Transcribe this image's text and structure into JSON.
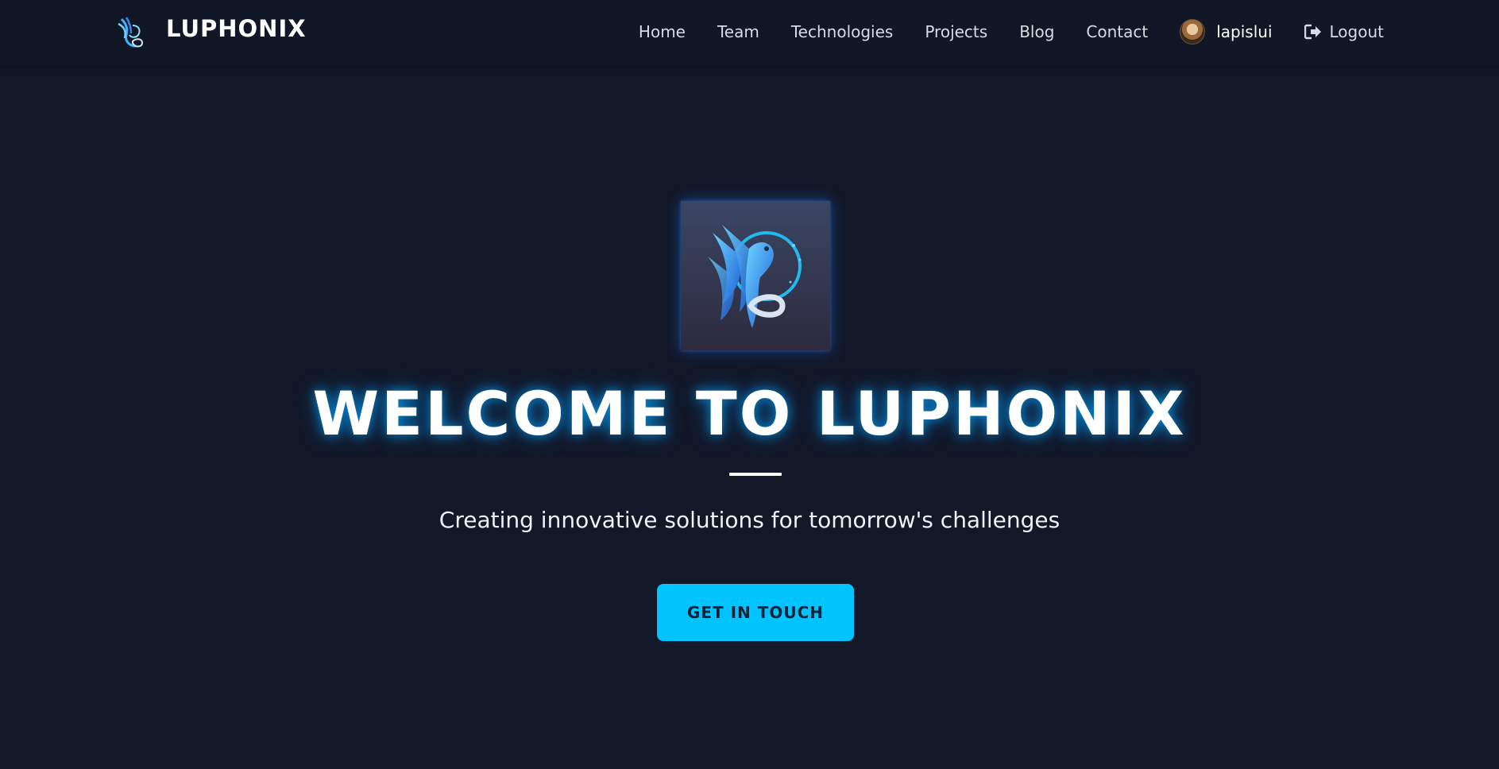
{
  "brand": {
    "name": "LUPHONIX",
    "logo_icon": "phoenix-logo-icon"
  },
  "nav": {
    "links": [
      {
        "label": "Home"
      },
      {
        "label": "Team"
      },
      {
        "label": "Technologies"
      },
      {
        "label": "Projects"
      },
      {
        "label": "Blog"
      },
      {
        "label": "Contact"
      }
    ],
    "user": {
      "name": "lapislui",
      "avatar_icon": "user-avatar"
    },
    "logout": {
      "label": "Logout",
      "icon": "sign-out-icon"
    }
  },
  "hero": {
    "logo_icon": "phoenix-emblem-icon",
    "title": "WELCOME TO LUPHONIX",
    "tagline": "Creating innovative solutions for tomorrow's challenges",
    "cta_label": "GET IN TOUCH"
  },
  "colors": {
    "background": "#121828",
    "navbar": "#111726",
    "accent": "#00c3ff",
    "title_glow": "#00aaff",
    "text": "#ffffff"
  }
}
